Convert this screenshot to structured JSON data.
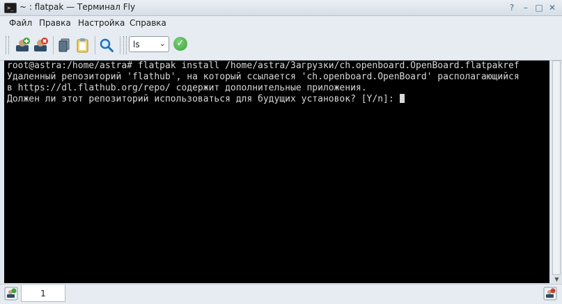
{
  "window": {
    "title": "~ : flatpak — Терминал Fly",
    "app_icon": ">_",
    "buttons": {
      "help": "?",
      "minimize": "–",
      "maximize": "□",
      "close": "✕"
    }
  },
  "menu": {
    "items": [
      "Файл",
      "Правка",
      "Настройка",
      "Справка"
    ]
  },
  "toolbar": {
    "command_value": "ls",
    "buttons": [
      "new-tab-icon",
      "close-tab-icon",
      "copy-icon",
      "paste-icon",
      "search-icon",
      "run-icon"
    ]
  },
  "terminal": {
    "lines": [
      "root@astra:/home/astra# flatpak install /home/astra/Загрузки/ch.openboard.OpenBoard.flatpakref",
      "Удаленный репозиторий 'flathub', на который ссылается 'ch.openboard.OpenBoard' располагающийся",
      "в https://dl.flathub.org/repo/ содержит дополнительные приложения.",
      "Должен ли этот репозиторий использоваться для будущих установок? [Y/n]: "
    ],
    "background": "#000000",
    "foreground": "#d8d8d8"
  },
  "tabs": {
    "items": [
      {
        "label": "1"
      }
    ]
  },
  "colors": {
    "accent": "#4a6e8a",
    "add_green": "#3ea43a",
    "remove_red": "#d03a2f"
  }
}
